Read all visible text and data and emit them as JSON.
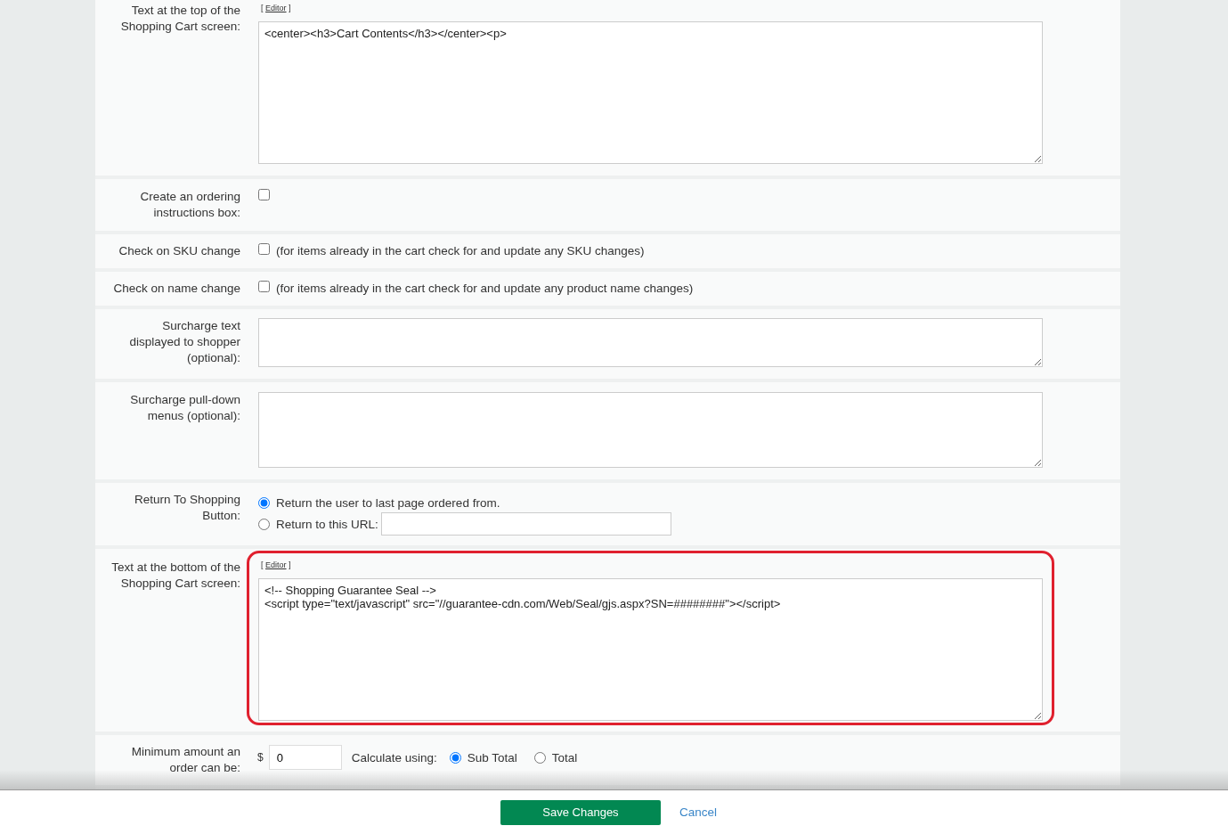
{
  "rows": [
    {
      "kind": "textarea",
      "label": [
        "Text at the top of the",
        "Shopping Cart screen:"
      ],
      "editor": {
        "open": "[",
        "link": "Editor",
        "close": "]"
      },
      "value": "<center><h3>Cart Contents</h3></center><p>",
      "highlighted": false
    },
    {
      "kind": "checkbox",
      "label": [
        "Create an ordering",
        "instructions box:"
      ],
      "checked": false
    },
    {
      "kind": "checkbox",
      "label": [
        "Check on SKU change"
      ],
      "checked": false,
      "note": "(for items already in the cart check for and update any SKU changes)"
    },
    {
      "kind": "checkbox",
      "label": [
        "Check on name change"
      ],
      "checked": false,
      "note": "(for items already in the cart check for and update any product name changes)"
    },
    {
      "kind": "textarea",
      "label": [
        "Surcharge text",
        "displayed to shopper",
        "(optional):"
      ],
      "highlighted": false
    },
    {
      "kind": "textarea",
      "label": [
        "Surcharge pull-down",
        "menus (optional):"
      ],
      "highlighted": false
    },
    {
      "kind": "radio",
      "label": [
        "Return To Shopping",
        "Button:"
      ],
      "options": [
        {
          "label": "Return the user to last page ordered from.",
          "selected": true,
          "has_field": false
        },
        {
          "label": "Return to this URL:",
          "selected": false,
          "has_field": true
        }
      ]
    },
    {
      "kind": "textarea",
      "label": [
        "Text at the bottom of the",
        "Shopping Cart screen:"
      ],
      "editor": {
        "open": "[",
        "link": "Editor",
        "close": "]"
      },
      "value": "<!-- Shopping Guarantee Seal -->\n<script type=\"text/javascript\" src=\"//guarantee-cdn.com/Web/Seal/gjs.aspx?SN=########\"></script>",
      "highlighted": true
    },
    {
      "kind": "amount",
      "label": [
        "Minimum amount an",
        "order can be:"
      ],
      "currency": "$",
      "value": "0",
      "calc_label": "Calculate using:",
      "options": [
        {
          "label": "Sub Total",
          "selected": true
        },
        {
          "label": "Total",
          "selected": false
        }
      ]
    }
  ],
  "footer": {
    "save": "Save Changes",
    "cancel": "Cancel"
  }
}
